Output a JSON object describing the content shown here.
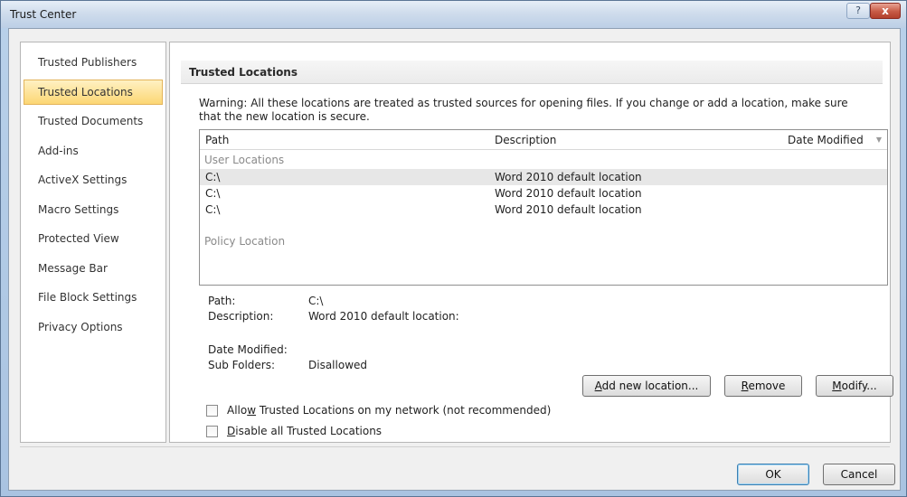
{
  "window": {
    "title": "Trust Center",
    "help_label": "?",
    "close_label": "x"
  },
  "sidebar": {
    "items": [
      {
        "label": "Trusted Publishers",
        "selected": false
      },
      {
        "label": "Trusted Locations",
        "selected": true
      },
      {
        "label": "Trusted Documents",
        "selected": false
      },
      {
        "label": "Add-ins",
        "selected": false
      },
      {
        "label": "ActiveX Settings",
        "selected": false
      },
      {
        "label": "Macro Settings",
        "selected": false
      },
      {
        "label": "Protected View",
        "selected": false
      },
      {
        "label": "Message Bar",
        "selected": false
      },
      {
        "label": "File Block Settings",
        "selected": false
      },
      {
        "label": "Privacy Options",
        "selected": false
      }
    ]
  },
  "main": {
    "section_title": "Trusted Locations",
    "warning_line1": "Warning: All these locations are treated as trusted sources for opening files.  If you change or add a location, make sure",
    "warning_line2": "that the new location is secure.",
    "table": {
      "columns": [
        "Path",
        "Description",
        "Date Modified"
      ],
      "sort_icon": "sort-descending-icon",
      "user_group_label": "User Locations",
      "policy_group_label": "Policy Location",
      "rows": [
        {
          "path": "C:\\",
          "description": "Word 2010 default location",
          "selected": true
        },
        {
          "path": "C:\\",
          "description": "Word 2010 default location",
          "selected": false
        },
        {
          "path": "C:\\",
          "description": "Word 2010 default location",
          "selected": false
        }
      ]
    },
    "details": {
      "path_label": "Path:",
      "path_value": "C:\\",
      "description_label": "Description:",
      "description_value": "Word 2010 default location:",
      "date_modified_label": "Date Modified:",
      "sub_folders_label": "Sub Folders:",
      "sub_folders_value": "Disallowed"
    },
    "buttons": {
      "add_new": {
        "before": "",
        "accel": "A",
        "after": "dd new location..."
      },
      "remove": {
        "before": "",
        "accel": "R",
        "after": "emove"
      },
      "modify": {
        "before": "",
        "accel": "M",
        "after": "odify..."
      }
    },
    "checkboxes": {
      "allow_network": {
        "before": "Allo",
        "accel": "w",
        "after": " Trusted Locations on my network (not recommended)",
        "checked": false
      },
      "disable_all": {
        "before": "",
        "accel": "D",
        "after": "isable all Trusted Locations",
        "checked": false
      }
    }
  },
  "footer": {
    "ok_label": "OK",
    "cancel_label": "Cancel"
  }
}
